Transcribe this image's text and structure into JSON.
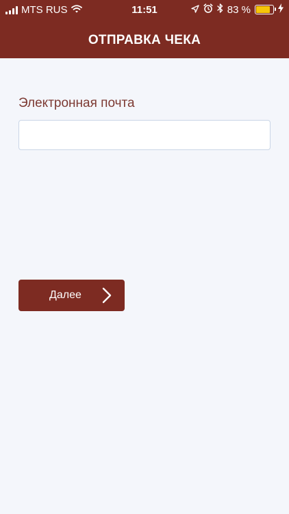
{
  "status_bar": {
    "carrier": "MTS RUS",
    "time": "11:51",
    "battery_percent": "83 %",
    "battery_level": 0.83
  },
  "nav": {
    "title": "ОТПРАВКА ЧЕКА"
  },
  "form": {
    "email_label": "Электронная почта",
    "email_value": ""
  },
  "next_button": {
    "label": "Далее"
  },
  "colors": {
    "brand": "#7d2b22",
    "background": "#f4f6fb",
    "label": "#7d3a33",
    "battery": "#f6c609"
  },
  "icons": {
    "signal": "signal-bars-icon",
    "wifi": "wifi-icon",
    "location": "location-arrow-icon",
    "alarm": "alarm-clock-icon",
    "bluetooth": "bluetooth-icon",
    "battery": "battery-icon",
    "charging": "charging-bolt-icon",
    "chevron": "chevron-right-icon"
  }
}
